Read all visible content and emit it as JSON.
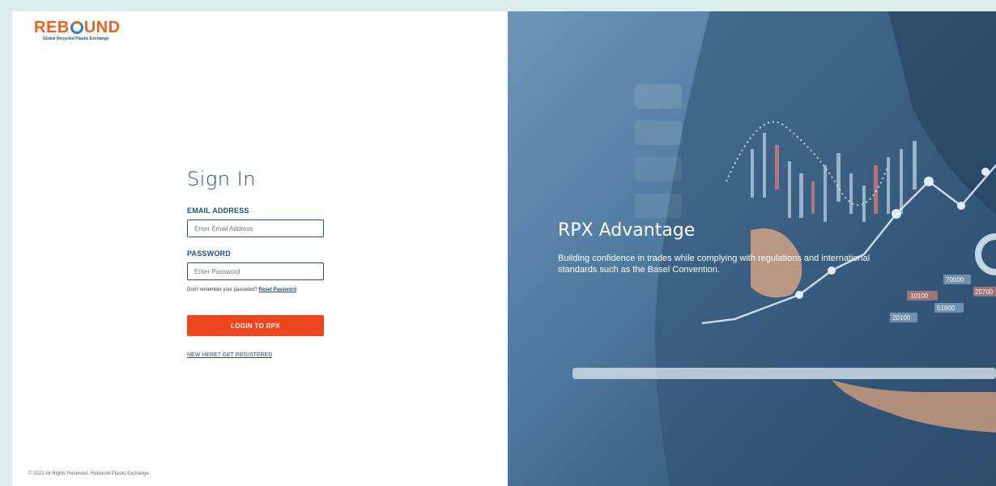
{
  "logo": {
    "word_left": "REB",
    "word_right": "UND",
    "tagline": "Global Recycled Plastic Exchange"
  },
  "form": {
    "title": "Sign In",
    "email_label": "EMAIL ADDRESS",
    "email_placeholder": "Enter Email Address",
    "email_value": "",
    "password_label": "PASSWORD",
    "password_placeholder": "Enter Password",
    "password_value": "",
    "forgot_text": "Don't remember your password?",
    "reset_link": "Reset Password",
    "login_button": "LOGIN TO RPX",
    "register_link": "NEW HERE? GET REGISTERED"
  },
  "footer": {
    "copyright": "© 2022 All Rights Reserved. Rebound Plastic Exchange."
  },
  "hero": {
    "title": "RPX Advantage",
    "description": "Building confidence in trades while complying with regulations and international standards such as the Basel Convention.",
    "chart_labels": [
      "70000",
      "10100",
      "51800",
      "25700",
      "20100"
    ]
  },
  "colors": {
    "accent": "#f0461e",
    "brand_orange": "#e8651f",
    "brand_blue": "#1f4f7a",
    "hero_bg": "#4f7aa0",
    "page_bg": "#dbeeed"
  }
}
